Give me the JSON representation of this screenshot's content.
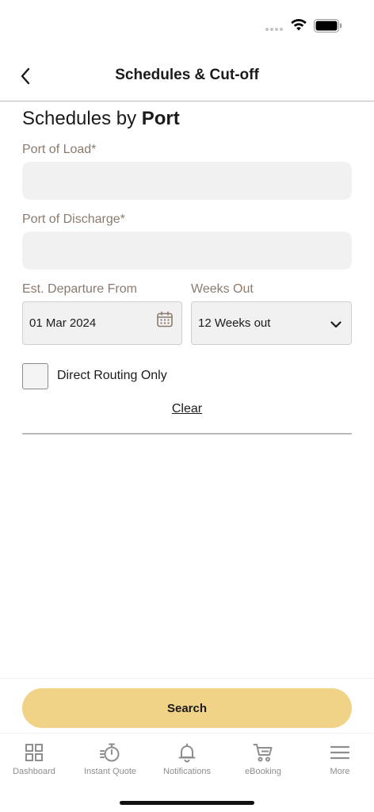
{
  "header": {
    "title": "Schedules & Cut-off"
  },
  "section": {
    "title_prefix": "Schedules by ",
    "title_bold": "Port"
  },
  "form": {
    "port_of_load": {
      "label": "Port of Load*",
      "value": ""
    },
    "port_of_discharge": {
      "label": "Port of Discharge*",
      "value": ""
    },
    "departure": {
      "label": "Est. Departure From",
      "value": "01 Mar 2024"
    },
    "weeks_out": {
      "label": "Weeks Out",
      "value": "12 Weeks out"
    },
    "direct_routing": {
      "label": "Direct Routing Only",
      "checked": false
    },
    "clear_label": "Clear"
  },
  "actions": {
    "search_label": "Search"
  },
  "tabs": [
    {
      "label": "Dashboard",
      "icon": "dashboard-icon"
    },
    {
      "label": "Instant Quote",
      "icon": "stopwatch-icon"
    },
    {
      "label": "Notifications",
      "icon": "bell-icon"
    },
    {
      "label": "eBooking",
      "icon": "cart-icon"
    },
    {
      "label": "More",
      "icon": "menu-icon"
    }
  ],
  "colors": {
    "accent": "#f0d386",
    "label": "#8b7a6d",
    "input_bg": "#f1f1f1",
    "tab_inactive": "#8e8e8e"
  }
}
